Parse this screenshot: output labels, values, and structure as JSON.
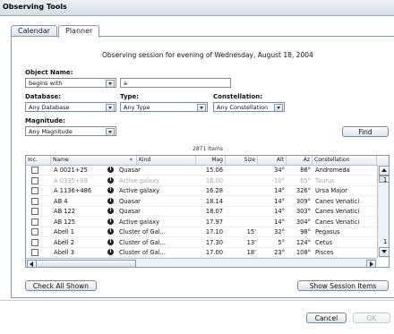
{
  "window": {
    "title": "Observing Tools"
  },
  "tabs": [
    {
      "label": "Calendar"
    },
    {
      "label": "Planner"
    }
  ],
  "session_title": "Observing session for evening of Wednesday, August 18, 2004",
  "filters": {
    "object_name_label": "Object Name:",
    "object_name_mode": "begins with",
    "object_name_value": "a",
    "database_label": "Database:",
    "database_value": "Any Database",
    "type_label": "Type:",
    "type_value": "Any Type",
    "constellation_label": "Constellation:",
    "constellation_value": "Any Constellation",
    "magnitude_label": "Magnitude:",
    "magnitude_value": "Any Magnitude",
    "find_label": "Find"
  },
  "results": {
    "count_text": "2871 Items",
    "columns": [
      "Inc.",
      "Name",
      "Kind",
      "Mag",
      "Size",
      "Alt",
      "Az",
      "Constellation"
    ],
    "rows": [
      {
        "name": "A 0021+25",
        "kind": "Quasar",
        "mag": "15.06",
        "size": "",
        "alt": "34°",
        "az": "86°",
        "con": "Andromeda",
        "extra": "",
        "dim": false
      },
      {
        "name": "A 0335+09",
        "kind": "Active galaxy",
        "mag": "16.00",
        "size": "",
        "alt": "-10°",
        "az": "65°",
        "con": "Taurus",
        "extra": "1",
        "dim": true
      },
      {
        "name": "A 1136+486",
        "kind": "Active galaxy",
        "mag": "16.28",
        "size": "",
        "alt": "14°",
        "az": "326°",
        "con": "Ursa Major",
        "extra": "",
        "dim": false
      },
      {
        "name": "AB  4",
        "kind": "Quasar",
        "mag": "18.14",
        "size": "",
        "alt": "14°",
        "az": "309°",
        "con": "Canes Venatici",
        "extra": "",
        "dim": false
      },
      {
        "name": "AB 122",
        "kind": "Quasar",
        "mag": "18.07",
        "size": "",
        "alt": "14°",
        "az": "303°",
        "con": "Canes Venatici",
        "extra": "",
        "dim": false
      },
      {
        "name": "AB 125",
        "kind": "Active galaxy",
        "mag": "17.97",
        "size": "",
        "alt": "14°",
        "az": "304°",
        "con": "Canes Venatici",
        "extra": "",
        "dim": false
      },
      {
        "name": "Abell 1",
        "kind": "Cluster of Gal...",
        "mag": "17.10",
        "size": "15'",
        "alt": "32°",
        "az": "98°",
        "con": "Pegasus",
        "extra": "",
        "dim": false
      },
      {
        "name": "Abell 2",
        "kind": "Cluster of Gal...",
        "mag": "17.30",
        "size": "13'",
        "alt": "5°",
        "az": "124°",
        "con": "Cetus",
        "extra": "1",
        "dim": false
      },
      {
        "name": "Abell 3",
        "kind": "Cluster of Gal...",
        "mag": "17.00",
        "size": "18'",
        "alt": "23°",
        "az": "108°",
        "con": "Pisces",
        "extra": "",
        "dim": false
      }
    ]
  },
  "actions": {
    "check_all": "Check All Shown",
    "show_session": "Show Session Items",
    "cancel": "Cancel",
    "ok": "OK"
  }
}
